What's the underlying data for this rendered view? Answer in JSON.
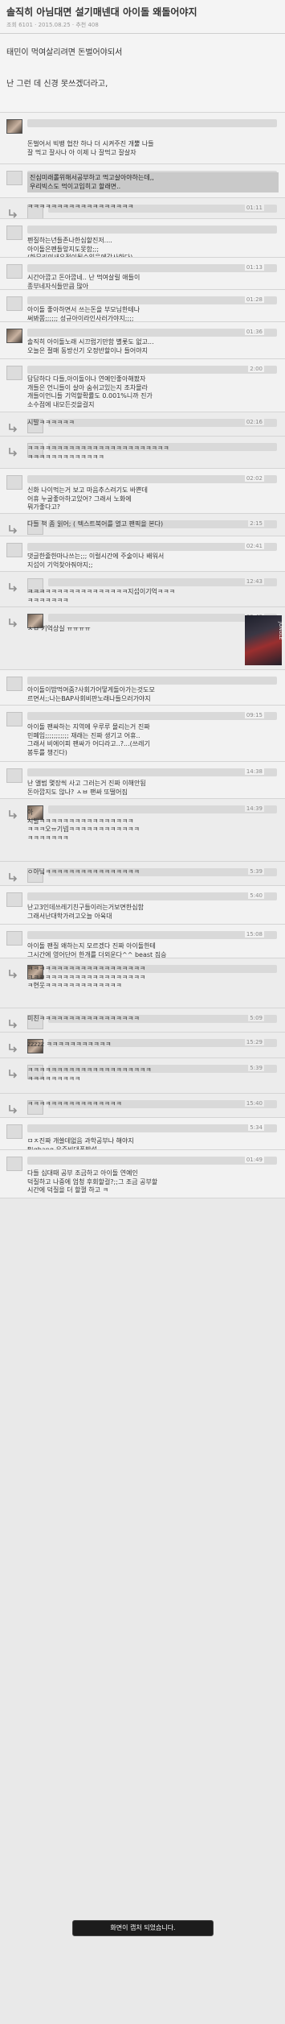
{
  "header": {
    "title": "솔직히 아님대면 설기매넨대 아이돌 왜돌어야지",
    "meta": "조회 6101 · 2015.08.25 · 추천 408"
  },
  "post": {
    "lines": [
      "태민이 먹여살리려면 돈벌어야되서",
      "난 그런 데 신경 못쓰겠더라고,"
    ]
  },
  "comments": [
    {
      "time": "",
      "reply": false,
      "photo": true,
      "text": "돈벌어서 빅뱅 협찬 하나 더 시켜주진 개뿔 나들\n잘 먹고 잘사나 아 이제 나 잘먹고 잘살자"
    },
    {
      "time": "",
      "reply": false,
      "photo": false,
      "hl": true,
      "text": "진심미래롤위해서공부하고 먹고살아야하는데,,\n우리빅스도 먹이고입히고 할래면.."
    },
    {
      "time": "01:11",
      "reply": true,
      "photo": false,
      "text": "ㅋㅋㅋㅋㅋㅋㅋㅋㅋㅋㅋㅋㅋㅋㅋㅋㅋㅋ"
    },
    {
      "time": "",
      "reply": false,
      "photo": false,
      "text": "펜질하는년들존나한심할진저....\n아이돌은펜들앞지도못함;;;\n(한무리의새우젓이될수있음에감사한다)"
    },
    {
      "time": "01:13",
      "reply": false,
      "photo": false,
      "text": "시간아깝고 돈아깝네.. 난 먹여살릴 애들이\n종부네자식들만큼 많아"
    },
    {
      "time": "01:28",
      "reply": false,
      "photo": false,
      "text": "아이돌 좋아하면서 쓰는돈을 부모님한테나\n써봐쫌;;;;;; 성규아이라인사러가야지;;;;"
    },
    {
      "time": "01:36",
      "reply": false,
      "photo": true,
      "text": "솔직히 아이돌노래 시끄럽기만함 별롯도 없고...\n오늘은 절매 동방신기 오정반할이나 들어야지"
    },
    {
      "time": "2:00",
      "reply": false,
      "photo": false,
      "text": "답답하다 다들,아이돌이나 연예인좋아해봤자\n개들은 언니들이 살아 숨쉬고있는지 조차몰라\n개들이언니들 기억할확률도 0.001%니까 진가\n소수점에 내모든것을걸지"
    },
    {
      "time": "02:16",
      "reply": true,
      "photo": false,
      "text": "시발ㅋㅋㅋㅋㅋㅋ"
    },
    {
      "time": "",
      "reply": true,
      "photo": false,
      "text": "ㅋㅋㅋㅋㅋㅋㅋㅋㅋㅋㅋㅋㅋㅋㅋㅋㅋㅋㅋㅋㅋㅋㅋㅋ\nㅋㅋㅋㅋㅋㅋㅋㅋㅋㅋㅋㅋㅋ"
    },
    {
      "time": "02:02",
      "reply": false,
      "photo": false,
      "text": "신화 나이먹는거 보고 마음추스려기도 바쁜데\n어휴 누굴좋아하고있어? 그래서 노화에\n뭐가좋다고?"
    },
    {
      "time": "2:15",
      "reply": true,
      "photo": false,
      "text": "다들 책 좀 읽어; ( 텍스트북어를 열고 팬픽을 본다)"
    },
    {
      "time": "02:41",
      "reply": false,
      "photo": false,
      "text": "댓글한줄한마나쓰는;;; 이럴시간에 주술이나 배워서\n지섭이 기억찾아줘야지;;"
    },
    {
      "time": "12:43",
      "reply": true,
      "photo": false,
      "text": "ㅋㅋㅋㅋㅋㅋㅋㅋㅋㅋㅋㅋㅋㅋㅋㅋㅋ지섭이기억ㅋㅋㅋ\nㅋㅋㅋㅋㅋㅋㅋ"
    },
    {
      "time": "32:43",
      "reply": true,
      "photo": true,
      "big": true,
      "text": "ㅅㅂ 기억상실 ㅠㅠㅠㅠ"
    },
    {
      "time": "",
      "reply": false,
      "photo": false,
      "text": "아이돌이밥먹여줌?사회가어떻게돌아가는것도모\n르면서;;나는BAP사회비판노래나들으러가야지"
    },
    {
      "time": "09:15",
      "reply": false,
      "photo": false,
      "text": "아이돌 팬싸하는 지역에 우루루 몰리는거 진짜\n민폐임;;;;;;;;;;; 재래는 진짜 생기고 어휴..\n그래서 비에이피 팬싸가 어디라고..?...(쓰레기\n봉투를 챙긴다)"
    },
    {
      "time": "14:38",
      "reply": false,
      "photo": false,
      "text": "난 앨범 몇장씩 사고 그러는거 진짜 이해안됨\n돈아깝지도 않나? ㅅㅂ 팬싸 또떨어짐"
    },
    {
      "time": "14:39",
      "reply": true,
      "photo": true,
      "text": "아\n시발ㅋㅋㅋㅋㅋㅋㅋㅋㅋㅋㅋㅋㅋㅋㅋㅋ\nㅋㅋㅋ오ㅠ기넵ㅋㅋㅋㅋㅋㅋㅋㅋㅋㅋㅋㅋ\nㅋㅋㅋㅋㅋㅋㅋ"
    },
    {
      "time": "5:39",
      "reply": true,
      "photo": false,
      "text": "ㅇ아닠ㅋㅋㅋㅋㅋㅋㅋㅋㅋㅋㅋㅋㅋㅋㅋㅋ"
    },
    {
      "time": "5:40",
      "reply": false,
      "photo": false,
      "text": "난고3인데쓰레기친구들이러는거보면한심함\n그래서난대학가려고오늘 아육대"
    },
    {
      "time": "15:08",
      "reply": false,
      "photo": false,
      "text": "아이돌 팬질 왜하는지 모르겠다 진짜 아이돌한테\n그시간에 영어단어 한개를 더외운다^^ beast 짐승"
    },
    {
      "time": "",
      "reply": true,
      "photo": true,
      "text": "ㅋㅋㅋㅋㅋㅋㅋㅋㅋㅋㅋㅋㅋㅋㅋㅋㅋㅋㅋㅋ\nㅋㅋㅋㅋㅋㅋㅋㅋㅋㅋㅋㅋㅋㅋㅋㅋㅋㅋㅋㅋ\nㅋ현웃ㅋㅋㅋㅋㅋㅋㅋㅋㅋㅋㅋㅋㅋ"
    },
    {
      "time": "5:09",
      "reply": true,
      "photo": false,
      "text": "미친ㅋㅋㅋㅋㅋㅋㅋㅋㅋㅋㅋㅋㅋㅋㅋㅋㅋ"
    },
    {
      "time": "15:29",
      "reply": true,
      "photo": true,
      "text": "zzzzz ㅋㅋㅋㅋㅋㅋㅋㅋㅋㅋㅋ"
    },
    {
      "time": "5:39",
      "reply": true,
      "photo": false,
      "text": "ㅋㅋㅋㅋㅋㅋㅋㅋㅋㅋㅋㅋㅋㅋㅋㅋㅋㅋㅋㅋㅋ\nㅋㅋㅋㅋㅋㅋㅋㅋㅋ"
    },
    {
      "time": "15:40",
      "reply": true,
      "photo": false,
      "text": "ㅋㅋㅋㅋㅋㅋㅋㅋㅋㅋㅋㅋㅋㅋㅋㅋ"
    },
    {
      "time": "5:34",
      "reply": false,
      "photo": false,
      "text": "ㅁㅈ진짜 개쓸데없음 과학공부나 해야지\nBigbang 우주비대폭발설"
    },
    {
      "time": "01:49",
      "reply": false,
      "photo": false,
      "text": "다들 십대때 공부 조금하고 아이돌 연예인\n덕질하고 나중에 엄청 후회할걸?;;그 조금 공부할\n시간에 덕질을 더 할껄 하고 ㅋ"
    }
  ],
  "overlay": {
    "capture_message": "화면이 캡처 되었습니다."
  },
  "side_label": "JUNGLE"
}
